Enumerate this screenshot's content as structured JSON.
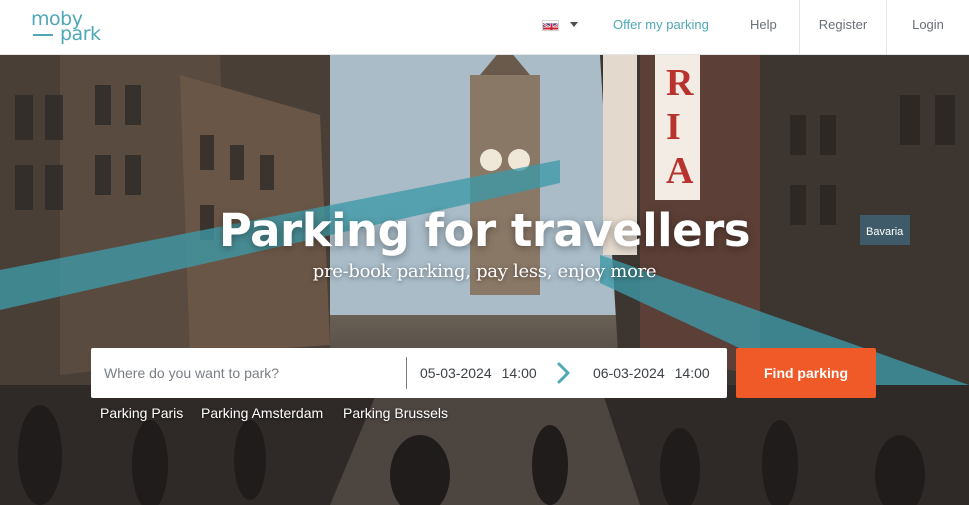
{
  "header": {
    "logo": {
      "line1": "moby",
      "line2": "park"
    },
    "language": {
      "icon": "uk-flag-icon",
      "caret_icon": "caret-down-icon"
    },
    "nav": {
      "offer_parking": "Offer my parking",
      "help": "Help",
      "register": "Register",
      "login": "Login"
    }
  },
  "hero": {
    "title": "Parking for travellers",
    "subtitle": "pre-book parking, pay less, enjoy more",
    "search": {
      "placeholder": "Where do you want to park?",
      "start_date": "05-03-2024",
      "start_time": "14:00",
      "end_date": "06-03-2024",
      "end_time": "14:00",
      "arrow_icon": "chevron-right-icon",
      "button": "Find parking"
    },
    "quick_links": [
      "Parking Paris",
      "Parking Amsterdam",
      "Parking Brussels"
    ]
  },
  "colors": {
    "brand_teal": "#4ea8b5",
    "cta_orange": "#f05a28",
    "nav_text": "#6b7076"
  }
}
